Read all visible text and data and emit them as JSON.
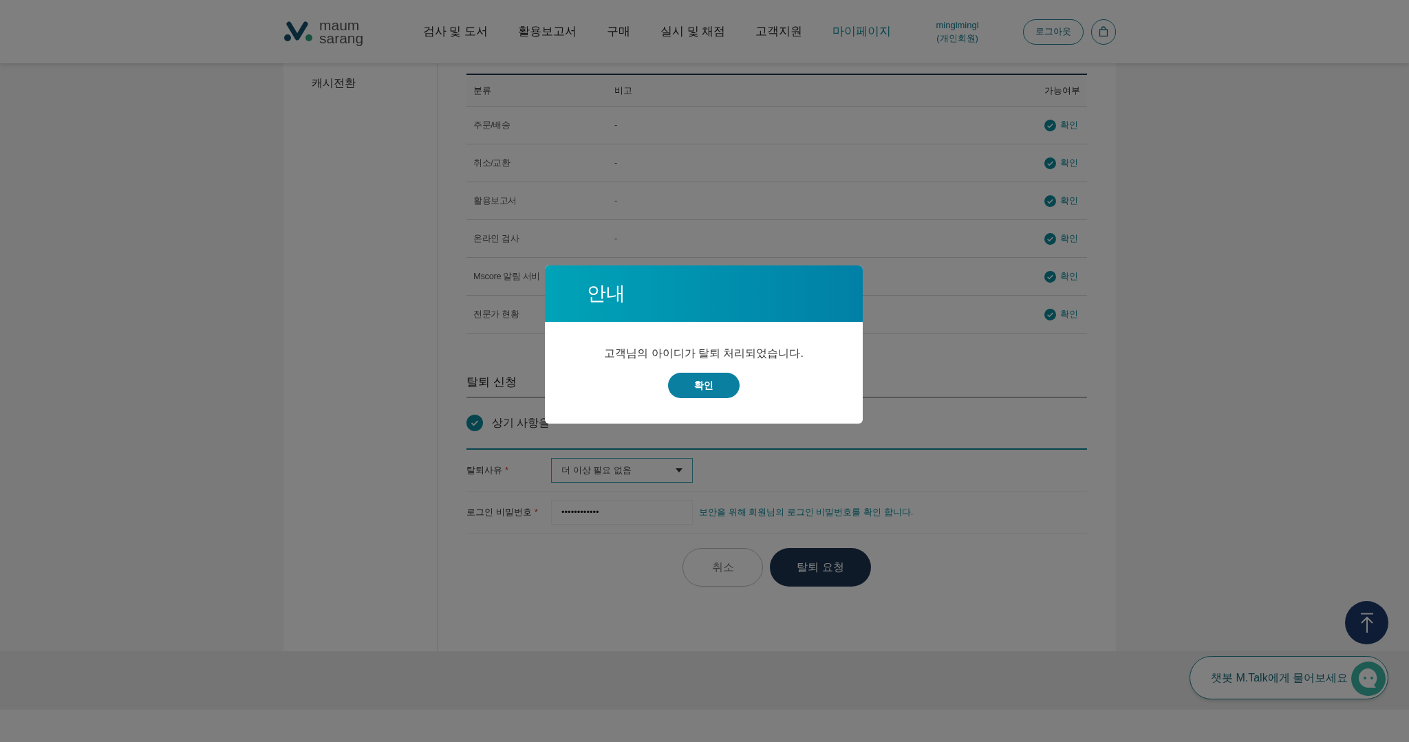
{
  "header": {
    "logo": {
      "line1": "maum",
      "line2": "sarang"
    },
    "nav": [
      {
        "label": "검사 및 도서",
        "selected": false
      },
      {
        "label": "활용보고서",
        "selected": false
      },
      {
        "label": "구매",
        "selected": false
      },
      {
        "label": "실시 및 채점",
        "selected": false
      },
      {
        "label": "고객지원",
        "selected": false
      },
      {
        "label": "마이페이지",
        "selected": true
      }
    ],
    "user": {
      "id": "minglmingl",
      "type": "(개인회원)"
    },
    "logout": "로그아웃"
  },
  "sidebar": {
    "items": [
      "캐시전환"
    ]
  },
  "table": {
    "columns": [
      "분류",
      "비고",
      "가능여부"
    ],
    "rows": [
      {
        "category": "주문/배송",
        "note": "-",
        "status": "확인"
      },
      {
        "category": "취소/교환",
        "note": "-",
        "status": "확인"
      },
      {
        "category": "활용보고서",
        "note": "-",
        "status": "확인"
      },
      {
        "category": "온라인 검사",
        "note": "-",
        "status": "확인"
      },
      {
        "category": "Mscore 알림 서비",
        "status": "확인"
      },
      {
        "category": "전문가 현황",
        "status": "확인"
      }
    ]
  },
  "withdrawal": {
    "title": "탈퇴 신청",
    "agree": {
      "label": "상기 사항을",
      "checked": true
    },
    "reason": {
      "label": "탈퇴사유",
      "required": "*",
      "value": "더 이상 필요 없음"
    },
    "password": {
      "label": "로그인 비밀번호",
      "required": "*",
      "value": "••••••••••••",
      "hint": "보안을 위해 회원님의 로그인 비밀번호를 확인 합니다."
    },
    "buttons": {
      "cancel": "취소",
      "submit": "탈퇴 요청"
    }
  },
  "chatbot": {
    "label": "챗봇 M.Talk에게 물어보세요"
  },
  "modal": {
    "title": "안내",
    "message": "고객님의 아이디가 탈퇴 처리되었습니다.",
    "button": "확인"
  }
}
